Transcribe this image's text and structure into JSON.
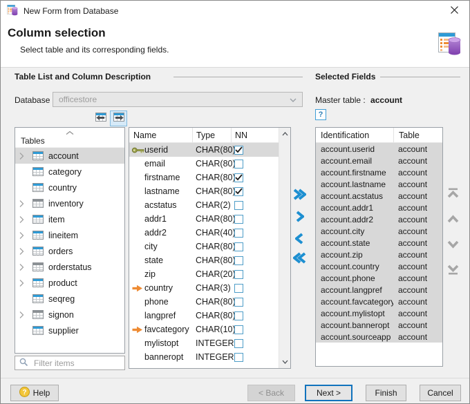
{
  "window": {
    "title": "New Form from Database"
  },
  "header": {
    "title": "Column selection",
    "subtitle": "Select table and its corresponding fields."
  },
  "left_group": {
    "title": "Table List and Column Description",
    "database_label": "Database :",
    "database_value": "officestore",
    "move_buttons": [
      {
        "icon": "table-move-left-icon",
        "active": false
      },
      {
        "icon": "table-move-right-icon",
        "active": true
      }
    ],
    "tables_header": "Tables",
    "tables": [
      {
        "name": "account",
        "expandable": true,
        "selected": true,
        "icon": "blue"
      },
      {
        "name": "category",
        "expandable": false,
        "selected": false,
        "icon": "blue"
      },
      {
        "name": "country",
        "expandable": false,
        "selected": false,
        "icon": "blue"
      },
      {
        "name": "inventory",
        "expandable": true,
        "selected": false,
        "icon": "gray"
      },
      {
        "name": "item",
        "expandable": true,
        "selected": false,
        "icon": "blue"
      },
      {
        "name": "lineitem",
        "expandable": true,
        "selected": false,
        "icon": "blue"
      },
      {
        "name": "orders",
        "expandable": true,
        "selected": false,
        "icon": "blue"
      },
      {
        "name": "orderstatus",
        "expandable": true,
        "selected": false,
        "icon": "gray"
      },
      {
        "name": "product",
        "expandable": true,
        "selected": false,
        "icon": "blue"
      },
      {
        "name": "seqreg",
        "expandable": false,
        "selected": false,
        "icon": "blue"
      },
      {
        "name": "signon",
        "expandable": true,
        "selected": false,
        "icon": "gray"
      },
      {
        "name": "supplier",
        "expandable": false,
        "selected": false,
        "icon": "blue"
      }
    ],
    "filter_placeholder": "Filter items"
  },
  "columns_table": {
    "headers": [
      "Name",
      "Type",
      "NN"
    ],
    "rows": [
      {
        "name": "userid",
        "type": "CHAR(80)",
        "nn": true,
        "icon": "primary-key",
        "selected": true
      },
      {
        "name": "email",
        "type": "CHAR(80)",
        "nn": false,
        "icon": null,
        "selected": false
      },
      {
        "name": "firstname",
        "type": "CHAR(80)",
        "nn": true,
        "icon": null,
        "selected": false
      },
      {
        "name": "lastname",
        "type": "CHAR(80)",
        "nn": true,
        "icon": null,
        "selected": false
      },
      {
        "name": "acstatus",
        "type": "CHAR(2)",
        "nn": false,
        "icon": null,
        "selected": false
      },
      {
        "name": "addr1",
        "type": "CHAR(80)",
        "nn": false,
        "icon": null,
        "selected": false
      },
      {
        "name": "addr2",
        "type": "CHAR(40)",
        "nn": false,
        "icon": null,
        "selected": false
      },
      {
        "name": "city",
        "type": "CHAR(80)",
        "nn": false,
        "icon": null,
        "selected": false
      },
      {
        "name": "state",
        "type": "CHAR(80)",
        "nn": false,
        "icon": null,
        "selected": false
      },
      {
        "name": "zip",
        "type": "CHAR(20)",
        "nn": false,
        "icon": null,
        "selected": false
      },
      {
        "name": "country",
        "type": "CHAR(3)",
        "nn": false,
        "icon": "foreign-key",
        "selected": false
      },
      {
        "name": "phone",
        "type": "CHAR(80)",
        "nn": false,
        "icon": null,
        "selected": false
      },
      {
        "name": "langpref",
        "type": "CHAR(80)",
        "nn": false,
        "icon": null,
        "selected": false
      },
      {
        "name": "favcategory",
        "type": "CHAR(10)",
        "nn": false,
        "icon": "foreign-key",
        "selected": false
      },
      {
        "name": "mylistopt",
        "type": "INTEGER",
        "nn": false,
        "icon": null,
        "selected": false
      },
      {
        "name": "banneropt",
        "type": "INTEGER",
        "nn": false,
        "icon": null,
        "selected": false
      }
    ]
  },
  "right_group": {
    "title": "Selected Fields",
    "master_label": "Master table :",
    "master_value": "account",
    "headers": [
      "Identification",
      "Table"
    ],
    "rows": [
      {
        "id": "account.userid",
        "table": "account"
      },
      {
        "id": "account.email",
        "table": "account"
      },
      {
        "id": "account.firstname",
        "table": "account"
      },
      {
        "id": "account.lastname",
        "table": "account"
      },
      {
        "id": "account.acstatus",
        "table": "account"
      },
      {
        "id": "account.addr1",
        "table": "account"
      },
      {
        "id": "account.addr2",
        "table": "account"
      },
      {
        "id": "account.city",
        "table": "account"
      },
      {
        "id": "account.state",
        "table": "account"
      },
      {
        "id": "account.zip",
        "table": "account"
      },
      {
        "id": "account.country",
        "table": "account"
      },
      {
        "id": "account.phone",
        "table": "account"
      },
      {
        "id": "account.langpref",
        "table": "account"
      },
      {
        "id": "account.favcategory",
        "table": "account"
      },
      {
        "id": "account.mylistopt",
        "table": "account"
      },
      {
        "id": "account.banneropt",
        "table": "account"
      },
      {
        "id": "account.sourceapp",
        "table": "account"
      }
    ]
  },
  "icons": {
    "question_mark": "?"
  },
  "footer": {
    "help": "Help",
    "back": "< Back",
    "next": "Next >",
    "finish": "Finish",
    "cancel": "Cancel"
  },
  "colors": {
    "accent_blue": "#2e9bd6",
    "selection_gray": "#d9d9d9",
    "transfer_blue": "#1d8fd1",
    "disabled_arrow_gray": "#a6a6a6",
    "foreign_key_orange": "#ee8b33",
    "primary_key_olive": "#a3a852"
  }
}
